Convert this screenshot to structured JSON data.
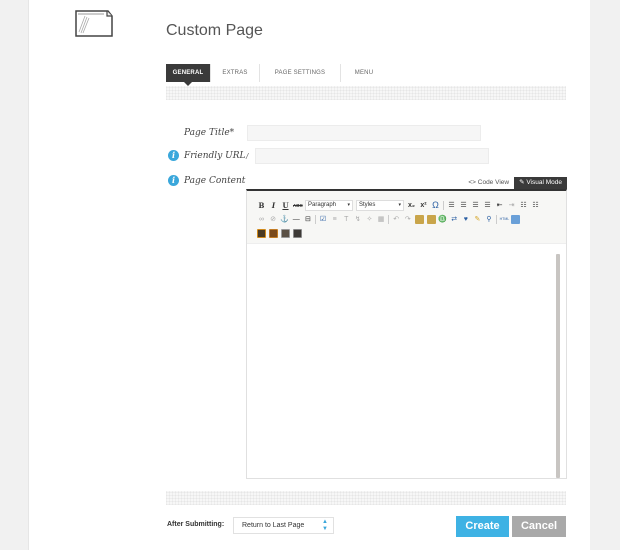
{
  "header": {
    "title": "Custom Page",
    "icon": "page-icon"
  },
  "tabs": [
    {
      "label": "GENERAL",
      "active": true
    },
    {
      "label": "EXTRAS",
      "active": false
    },
    {
      "label": "PAGE SETTINGS",
      "active": false
    },
    {
      "label": "MENU",
      "active": false
    }
  ],
  "form": {
    "page_title": {
      "label": "Page Title*",
      "value": "",
      "placeholder": ""
    },
    "friendly_url": {
      "label": "Friendly URL",
      "prefix": "/",
      "value": "",
      "placeholder": "",
      "info_icon": "info-icon"
    },
    "page_content": {
      "label": "Page Content",
      "info_icon": "info-icon"
    }
  },
  "editor": {
    "modes": [
      {
        "label": "<> Code View",
        "active": false
      },
      {
        "label": "Visual Mode",
        "active": true
      }
    ],
    "toolbar": {
      "format_select": "Paragraph",
      "styles_select": "Styles",
      "row1": [
        "bold-icon",
        "italic-icon",
        "underline-icon",
        "strikethrough-icon",
        "format-select",
        "styles-select",
        "subscript-icon",
        "superscript-icon",
        "omega-icon",
        "align-left-icon",
        "align-center-icon",
        "align-right-icon",
        "align-justify-icon",
        "outdent-icon",
        "indent-icon",
        "bullet-list-icon",
        "numbered-list-icon"
      ],
      "row2": [
        "link-icon",
        "unlink-icon",
        "anchor-icon",
        "horizontal-rule-icon",
        "page-break-icon",
        "edit-icon",
        "clear-icon",
        "text-color-icon",
        "remove-format-icon",
        "cleanup-icon",
        "table-icon",
        "undo-icon",
        "redo-icon",
        "paste-icon",
        "paste-word-icon",
        "find-icon",
        "replace-icon",
        "spellcheck-icon",
        "brush-icon",
        "preview-icon",
        "html-icon",
        "image-icon"
      ],
      "row3": [
        "media-icon",
        "flash-icon",
        "gallery-icon",
        "template-icon"
      ],
      "labels": {
        "bold": "B",
        "italic": "I",
        "underline": "U",
        "strike": "ABC",
        "sub": "x₂",
        "sup": "x²",
        "omega": "Ω",
        "html": "HTML"
      }
    },
    "content": ""
  },
  "footer": {
    "after_submitting_label": "After Submitting:",
    "after_submitting_value": "Return to Last Page",
    "create_label": "Create",
    "cancel_label": "Cancel"
  },
  "colors": {
    "accent": "#3eb2e4",
    "info": "#3aa7db",
    "tab_active": "#3a3a3a",
    "cancel": "#a9a9a9"
  }
}
